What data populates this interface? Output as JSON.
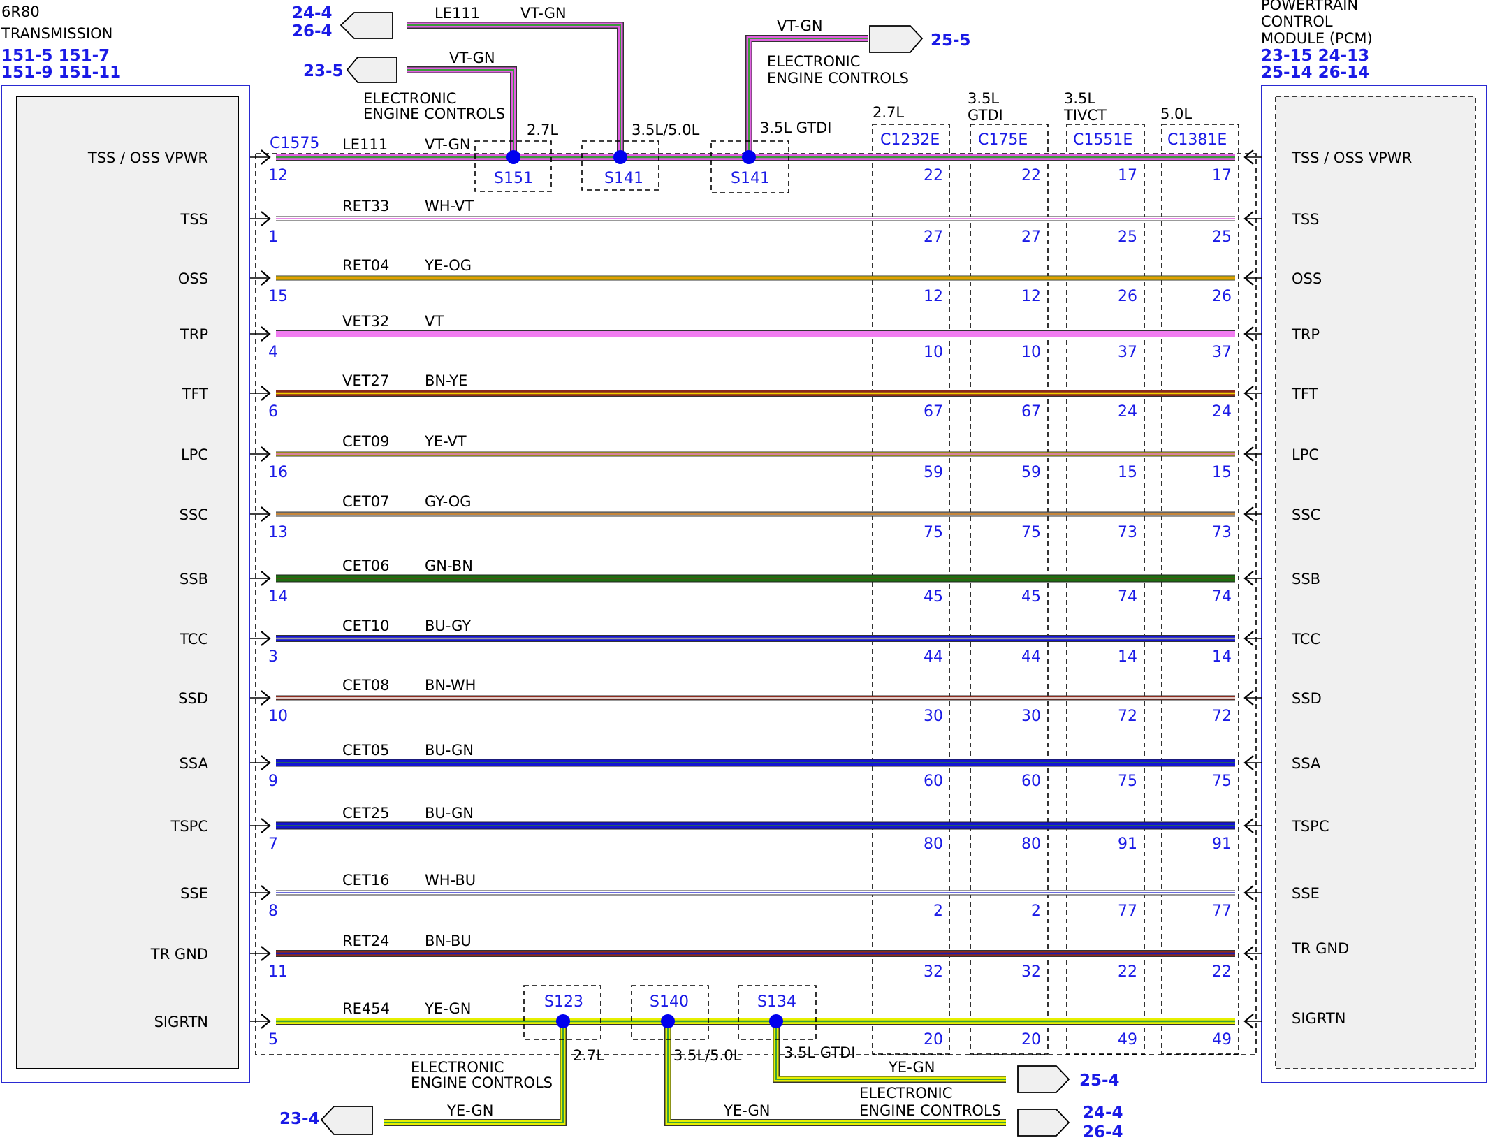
{
  "left_module": {
    "title": [
      "6R80",
      "TRANSMISSION"
    ],
    "refs": [
      "151-5 151-7",
      "151-9  151-11"
    ]
  },
  "right_module": {
    "title": [
      "POWERTRAIN",
      "CONTROL",
      "MODULE (PCM)"
    ],
    "refs": [
      "23-15 24-13",
      "25-14 26-14"
    ]
  },
  "connector": "C1575",
  "engine_columns": [
    {
      "variant": [
        "2.7L"
      ],
      "connector": "C1232E"
    },
    {
      "variant": [
        "3.5L",
        "GTDI"
      ],
      "connector": "C175E"
    },
    {
      "variant": [
        "3.5L",
        "TIVCT"
      ],
      "connector": "C1551E"
    },
    {
      "variant": [
        "5.0L"
      ],
      "connector": "C1381E"
    }
  ],
  "circuits": [
    {
      "signal": "TSS / OSS VPWR",
      "circuit": "LE111",
      "color_code": "VT-GN",
      "pin": "12",
      "pins": [
        "22",
        "22",
        "17",
        "17"
      ],
      "colors": [
        "#e060e0",
        "#3a9a3a"
      ],
      "variant": "stripe"
    },
    {
      "signal": "TSS",
      "circuit": "RET33",
      "color_code": "WH-VT",
      "pin": "1",
      "pins": [
        "27",
        "27",
        "25",
        "25"
      ],
      "colors": [
        "#ffffff",
        "#e060e0"
      ],
      "variant": "thin"
    },
    {
      "signal": "OSS",
      "circuit": "RET04",
      "color_code": "YE-OG",
      "pin": "15",
      "pins": [
        "12",
        "12",
        "26",
        "26"
      ],
      "colors": [
        "#f2e200",
        "#e08a00"
      ],
      "variant": "thin"
    },
    {
      "signal": "TRP",
      "circuit": "VET32",
      "color_code": "VT",
      "pin": "4",
      "pins": [
        "10",
        "10",
        "37",
        "37"
      ],
      "colors": [
        "#f07cf0"
      ],
      "variant": "solid"
    },
    {
      "signal": "TFT",
      "circuit": "VET27",
      "color_code": "BN-YE",
      "pin": "6",
      "pins": [
        "67",
        "67",
        "24",
        "24"
      ],
      "colors": [
        "#8b2a1c",
        "#f2d000"
      ],
      "variant": "stripe"
    },
    {
      "signal": "LPC",
      "circuit": "CET09",
      "color_code": "YE-VT",
      "pin": "16",
      "pins": [
        "59",
        "59",
        "15",
        "15"
      ],
      "colors": [
        "#f2e200",
        "#d060d0"
      ],
      "variant": "thin"
    },
    {
      "signal": "SSC",
      "circuit": "CET07",
      "color_code": "GY-OG",
      "pin": "13",
      "pins": [
        "75",
        "75",
        "73",
        "73"
      ],
      "colors": [
        "#909090",
        "#d9821e"
      ],
      "variant": "thin"
    },
    {
      "signal": "SSB",
      "circuit": "CET06",
      "color_code": "GN-BN",
      "pin": "14",
      "pins": [
        "45",
        "45",
        "74",
        "74"
      ],
      "colors": [
        "#1f6e10",
        "#6b3a1c"
      ],
      "variant": "solid2"
    },
    {
      "signal": "TCC",
      "circuit": "CET10",
      "color_code": "BU-GY",
      "pin": "3",
      "pins": [
        "44",
        "44",
        "14",
        "14"
      ],
      "colors": [
        "#1414d2",
        "#9a9a9a"
      ],
      "variant": "stripe"
    },
    {
      "signal": "SSD",
      "circuit": "CET08",
      "color_code": "BN-WH",
      "pin": "10",
      "pins": [
        "30",
        "30",
        "72",
        "72"
      ],
      "colors": [
        "#8b2a1c",
        "#ffffff"
      ],
      "variant": "thin"
    },
    {
      "signal": "SSA",
      "circuit": "CET05",
      "color_code": "BU-GN",
      "pin": "9",
      "pins": [
        "60",
        "60",
        "75",
        "75"
      ],
      "colors": [
        "#1414d2",
        "#2a8a2a"
      ],
      "variant": "solid2"
    },
    {
      "signal": "TSPC",
      "circuit": "CET25",
      "color_code": "BU-GN",
      "pin": "7",
      "pins": [
        "80",
        "80",
        "91",
        "91"
      ],
      "colors": [
        "#1414d2",
        "#2a8a2a"
      ],
      "variant": "solid2"
    },
    {
      "signal": "SSE",
      "circuit": "CET16",
      "color_code": "WH-BU",
      "pin": "8",
      "pins": [
        "2",
        "2",
        "77",
        "77"
      ],
      "colors": [
        "#ffffff",
        "#3a3ad2"
      ],
      "variant": "thin"
    },
    {
      "signal": "TR GND",
      "circuit": "RET24",
      "color_code": "BN-BU",
      "pin": "11",
      "pins": [
        "32",
        "32",
        "22",
        "22"
      ],
      "colors": [
        "#8b2a1c",
        "#1a1ab0"
      ],
      "variant": "stripe"
    },
    {
      "signal": "SIGRTN",
      "circuit": "RE454",
      "color_code": "YE-GN",
      "pin": "5",
      "pins": [
        "20",
        "20",
        "49",
        "49"
      ],
      "colors": [
        "#e6f000",
        "#3aa03a"
      ],
      "variant": "stripe"
    }
  ],
  "top_splices": [
    {
      "id": "S151",
      "variant": "2.7L"
    },
    {
      "id": "S141",
      "variant": "3.5L/5.0L"
    },
    {
      "id": "S141",
      "variant": "3.5L GTDI"
    }
  ],
  "bottom_splices": [
    {
      "id": "S123",
      "variant": "2.7L"
    },
    {
      "id": "S140",
      "variant": "3.5L/5.0L"
    },
    {
      "id": "S134",
      "variant": "3.5L GTDI"
    }
  ],
  "top_branches": {
    "b1": {
      "color_code": "VT-GN",
      "ref": "23-5",
      "note": [
        "ELECTRONIC",
        "ENGINE CONTROLS"
      ]
    },
    "b2": {
      "circuit": "LE111",
      "color_code": "VT-GN",
      "refs": [
        "24-4",
        "26-4"
      ]
    },
    "b3": {
      "color_code": "VT-GN",
      "ref": "25-5",
      "note": [
        "ELECTRONIC",
        "ENGINE CONTROLS"
      ]
    }
  },
  "bottom_branches": {
    "b1": {
      "color_code": "YE-GN",
      "ref": "23-4",
      "note": [
        "ELECTRONIC",
        "ENGINE CONTROLS"
      ]
    },
    "b2": {
      "color_code": "YE-GN",
      "refs": [
        "24-4",
        "26-4"
      ],
      "note": [
        "ELECTRONIC",
        "ENGINE CONTROLS"
      ]
    },
    "b3": {
      "color_code": "YE-GN",
      "ref": "25-4"
    }
  },
  "colors": {
    "pin_blue": "#1a1ae6",
    "module_border": "#2a2ad2",
    "module_fill": "#f0f0f0",
    "splice_dot": "#0000ee"
  }
}
